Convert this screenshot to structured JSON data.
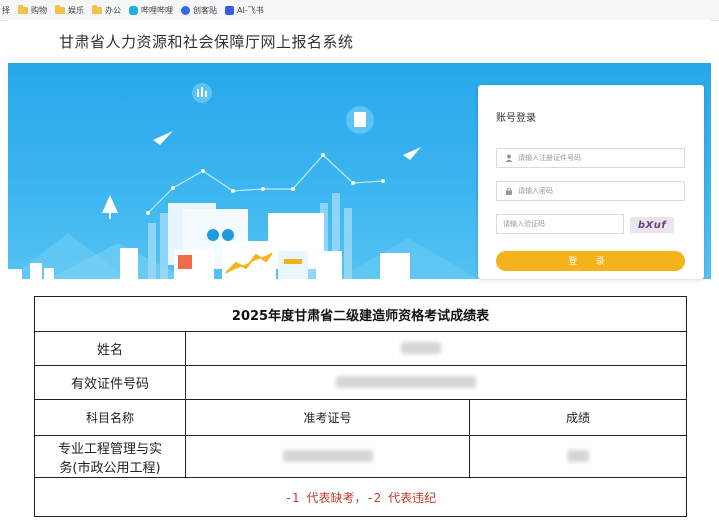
{
  "bookmarks": [
    {
      "label": "择",
      "icon": "none"
    },
    {
      "label": "购物",
      "icon": "folder-icon"
    },
    {
      "label": "娱乐",
      "icon": "folder-icon"
    },
    {
      "label": "办公",
      "icon": "folder-icon"
    },
    {
      "label": "哔哩哔哩",
      "icon": "bilibili-icon"
    },
    {
      "label": "创客贴",
      "icon": "chuangketie-icon"
    },
    {
      "label": "AI-飞书",
      "icon": "feishu-icon"
    }
  ],
  "site": {
    "title": "甘肃省人力资源和社会保障厅网上报名系统"
  },
  "login": {
    "title": "账号登录",
    "id_placeholder": "请输入注册证件号码",
    "password_placeholder": "请输入密码",
    "captcha_placeholder": "请输入验证码",
    "captcha_text": "bXuf",
    "submit_label": "登 录"
  },
  "score_table": {
    "title": "2025年度甘肃省二级建造师资格考试成绩表",
    "name_label": "姓名",
    "id_label": "有效证件号码",
    "subject_header": "科目名称",
    "ticket_header": "准考证号",
    "score_header": "成绩",
    "subject_line1": "专业工程管理与实",
    "subject_line2": "务(市政公用工程)",
    "note": "-1 代表缺考，-2 代表违纪"
  },
  "colors": {
    "banner": "#3db6f0",
    "login_button": "#f6b21b",
    "note_text": "#c0392b"
  }
}
